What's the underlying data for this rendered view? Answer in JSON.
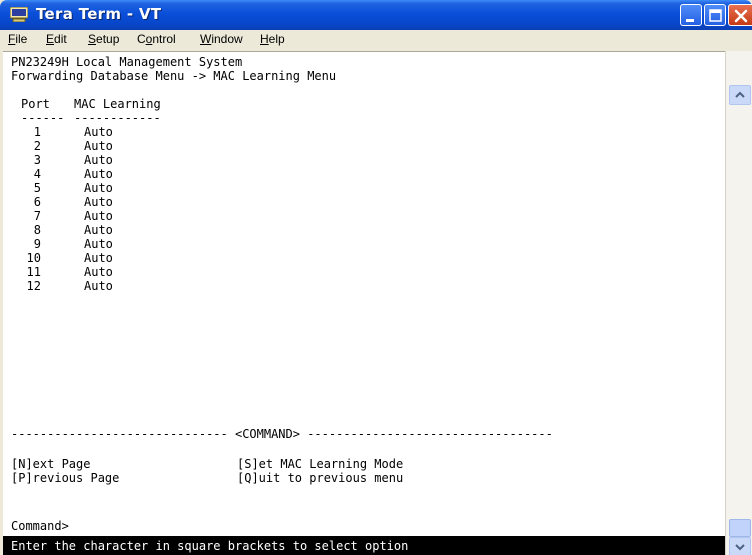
{
  "window": {
    "title": "Tera Term - VT"
  },
  "menu": {
    "file": {
      "mnemonic": "F",
      "rest": "ile"
    },
    "edit": {
      "mnemonic": "E",
      "rest": "dit"
    },
    "setup": {
      "mnemonic": "S",
      "rest": "etup"
    },
    "control": {
      "pre": "C",
      "mnemonic": "o",
      "rest": "ntrol"
    },
    "window": {
      "mnemonic": "W",
      "rest": "indow"
    },
    "help": {
      "mnemonic": "H",
      "rest": "elp"
    }
  },
  "terminal": {
    "system_title": "PN23249H Local Management System",
    "breadcrumb": "Forwarding Database Menu -> MAC Learning Menu",
    "table": {
      "headers": {
        "port": "Port",
        "mac_learning": "MAC Learning"
      },
      "header_rule": {
        "port": "------",
        "mac_learning": "------------"
      },
      "rows": [
        {
          "port": "1",
          "mode": "Auto"
        },
        {
          "port": "2",
          "mode": "Auto"
        },
        {
          "port": "3",
          "mode": "Auto"
        },
        {
          "port": "4",
          "mode": "Auto"
        },
        {
          "port": "5",
          "mode": "Auto"
        },
        {
          "port": "6",
          "mode": "Auto"
        },
        {
          "port": "7",
          "mode": "Auto"
        },
        {
          "port": "8",
          "mode": "Auto"
        },
        {
          "port": "9",
          "mode": "Auto"
        },
        {
          "port": "10",
          "mode": "Auto"
        },
        {
          "port": "11",
          "mode": "Auto"
        },
        {
          "port": "12",
          "mode": "Auto"
        }
      ]
    },
    "command_rule": "------------------------------ <COMMAND> ----------------------------------",
    "commands": {
      "next_page": "[N]ext Page",
      "previous_page": "[P]revious Page",
      "set_mode": "[S]et MAC Learning Mode",
      "quit": "[Q]uit to previous menu"
    },
    "prompt": "Command>",
    "status": "Enter the character in square brackets to select option"
  },
  "colors": {
    "titlebar": "#0a4fd9",
    "terminal_bg": "#ffffff",
    "terminal_fg": "#000000",
    "status_bg": "#000000",
    "status_fg": "#ffffff",
    "close_button": "#c43a14"
  },
  "icons": [
    "terminal-app-icon",
    "minimize-icon",
    "maximize-icon",
    "close-icon",
    "scroll-up-icon",
    "scroll-down-icon"
  ]
}
